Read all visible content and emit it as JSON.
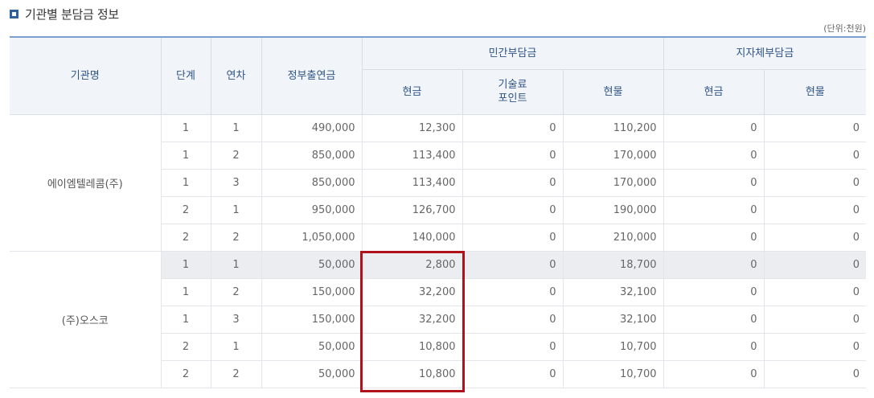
{
  "section": {
    "title": "기관별 분담금 정보",
    "unit": "(단위:천원)"
  },
  "headers": {
    "org": "기관명",
    "stage": "단계",
    "year": "연차",
    "gov": "정부출연금",
    "private_group": "민간부담금",
    "local_group": "지자체부담금",
    "private_cash": "현금",
    "private_tech_line1": "기술료",
    "private_tech_line2": "포인트",
    "private_inkind": "현물",
    "local_cash": "현금",
    "local_inkind": "현물"
  },
  "orgs": [
    "에이엠텔레콤(주)",
    "(주)오스코"
  ],
  "rows": [
    [
      "1",
      "1",
      "490,000",
      "12,300",
      "0",
      "110,200",
      "0",
      "0"
    ],
    [
      "1",
      "2",
      "850,000",
      "113,400",
      "0",
      "170,000",
      "0",
      "0"
    ],
    [
      "1",
      "3",
      "850,000",
      "113,400",
      "0",
      "170,000",
      "0",
      "0"
    ],
    [
      "2",
      "1",
      "950,000",
      "126,700",
      "0",
      "190,000",
      "0",
      "0"
    ],
    [
      "2",
      "2",
      "1,050,000",
      "140,000",
      "0",
      "210,000",
      "0",
      "0"
    ],
    [
      "1",
      "1",
      "50,000",
      "2,800",
      "0",
      "18,700",
      "0",
      "0"
    ],
    [
      "1",
      "2",
      "150,000",
      "32,200",
      "0",
      "32,100",
      "0",
      "0"
    ],
    [
      "1",
      "3",
      "150,000",
      "32,200",
      "0",
      "32,100",
      "0",
      "0"
    ],
    [
      "2",
      "1",
      "50,000",
      "10,800",
      "0",
      "10,700",
      "0",
      "0"
    ],
    [
      "2",
      "2",
      "50,000",
      "10,800",
      "0",
      "10,700",
      "0",
      "0"
    ]
  ],
  "colors": {
    "accent": "#2e5f9e",
    "header_text": "#2f5486",
    "highlight_row": "#ecedf1",
    "annotation_box": "#b0121b"
  }
}
